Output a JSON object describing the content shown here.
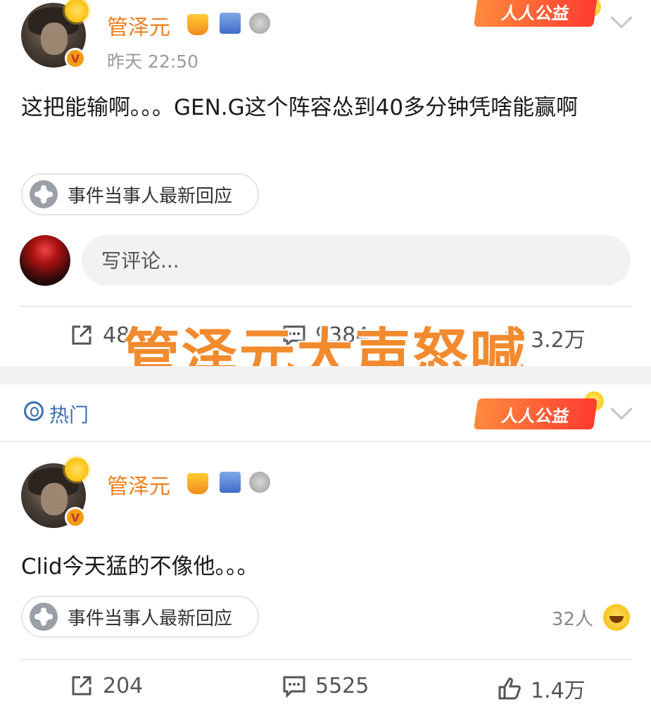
{
  "post1": {
    "username": "管泽元",
    "timestamp": "昨天 22:50",
    "content": "这把能输啊。。。GEN.G这个阵容怂到40多分钟凭啥能赢啊",
    "tag_label": "事件当事人最新回应",
    "charity_label": "人人公益",
    "comment_placeholder": "写评论...",
    "actions": {
      "repost": "48",
      "comment": "9384",
      "like": "3.2万"
    }
  },
  "overlay_caption": "管泽元大声怒喊",
  "hot_section": {
    "label": "热门",
    "charity_label": "人人公益"
  },
  "post2": {
    "username": "管泽元",
    "content": "Clid今天猛的不像他。。。",
    "tag_label": "事件当事人最新回应",
    "reaction_count": "32人",
    "actions": {
      "repost": "204",
      "comment": "5525",
      "like": "1.4万"
    }
  },
  "colors": {
    "username": "#f07d1a",
    "hot": "#3a6fb0",
    "caption": "#f28a2e"
  }
}
